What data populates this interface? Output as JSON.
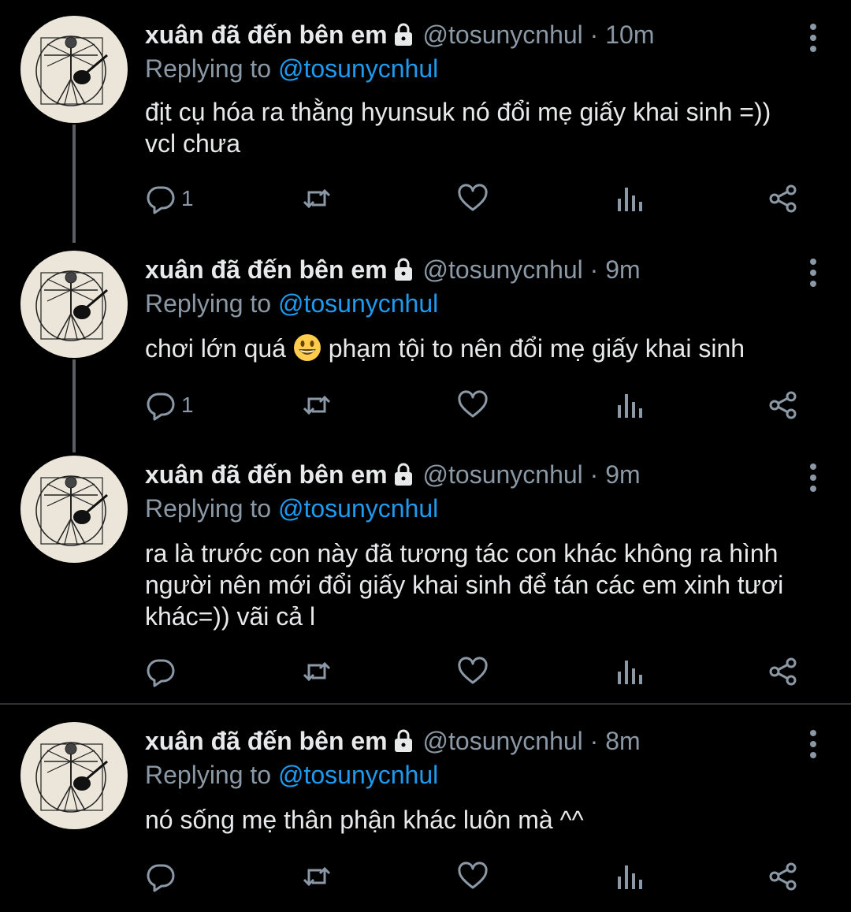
{
  "tweets": [
    {
      "name": "xuân đã đến bên em",
      "handle": "@tosunycnhul",
      "dot": "·",
      "time": "10m",
      "replying_label": "Replying to",
      "replying_to": "@tosunycnhul",
      "text_lines": [
        "địt cụ hóa ra thằng hyunsuk nó đổi mẹ giấy khai sinh =))",
        "vcl chưa"
      ],
      "reply_count": "1"
    },
    {
      "name": "xuân đã đến bên em",
      "handle": "@tosunycnhul",
      "dot": "·",
      "time": "9m",
      "replying_label": "Replying to",
      "replying_to": "@tosunycnhul",
      "text_before_emoji": "chơi lớn quá",
      "text_after_emoji": "phạm tội to nên đổi mẹ giấy khai sinh",
      "emoji": "grinning-face",
      "reply_count": "1"
    },
    {
      "name": "xuân đã đến bên em",
      "handle": "@tosunycnhul",
      "dot": "·",
      "time": "9m",
      "replying_label": "Replying to",
      "replying_to": "@tosunycnhul",
      "text_lines": [
        "ra là trước con này đã tương tác con khác không ra hình",
        "người nên mới đổi giấy khai sinh để tán các em xinh tươi",
        "khác=)) vãi cả l"
      ],
      "reply_count": ""
    },
    {
      "name": "xuân đã đến bên em",
      "handle": "@tosunycnhul",
      "dot": "·",
      "time": "8m",
      "replying_label": "Replying to",
      "replying_to": "@tosunycnhul",
      "text_lines": [
        "nó sống mẹ thân phận khác luôn mà ^^"
      ],
      "reply_count": ""
    }
  ],
  "icons": [
    "lock-icon",
    "more-vertical-icon",
    "reply-icon",
    "retweet-icon",
    "like-icon",
    "analytics-icon",
    "share-icon"
  ],
  "colors": {
    "background": "#000000",
    "text": "#e7e9ea",
    "secondary": "#8b98a5",
    "accent": "#1d9bf0",
    "avatar_bg": "#ece6da"
  }
}
